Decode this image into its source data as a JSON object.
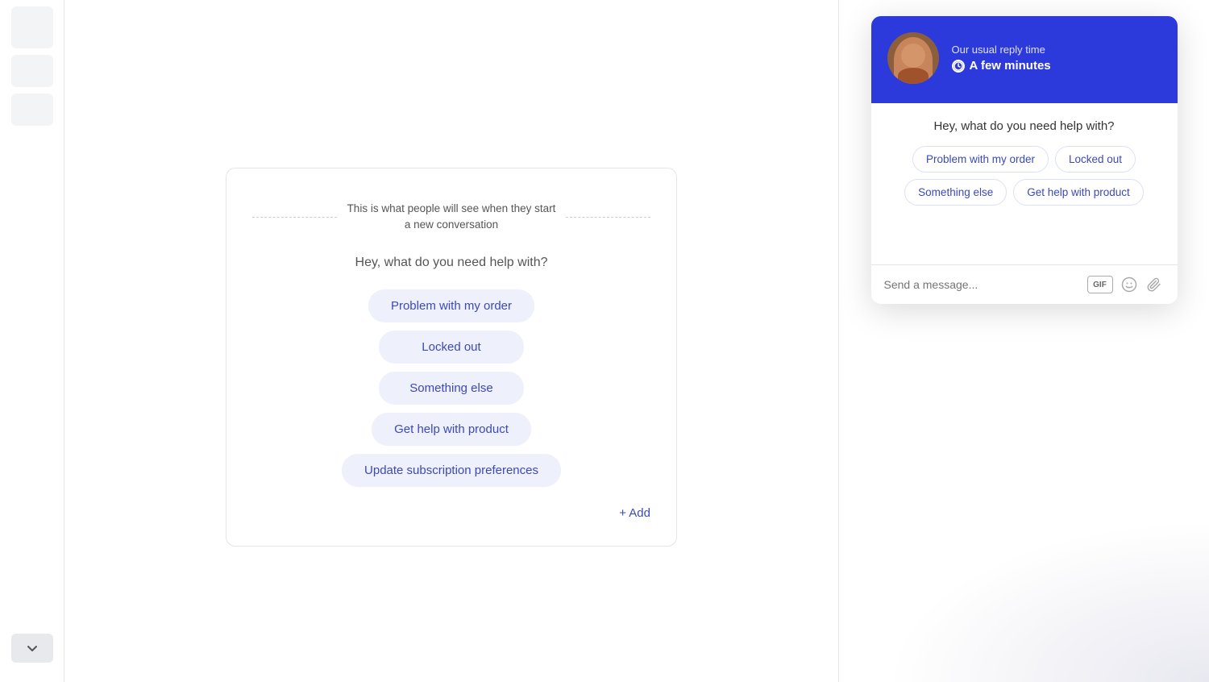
{
  "sidebar": {
    "items": [
      {
        "id": "item1"
      },
      {
        "id": "item2"
      },
      {
        "id": "item3"
      },
      {
        "id": "item4"
      }
    ],
    "dropdown_label": "▾"
  },
  "editor": {
    "divider_text": "This is what people will see when they start a new conversation",
    "prompt_text": "Hey, what do you need help with?",
    "options": [
      {
        "label": "Problem with my order"
      },
      {
        "label": "Locked out"
      },
      {
        "label": "Something else"
      },
      {
        "label": "Get help with product"
      },
      {
        "label": "Update subscription preferences"
      }
    ],
    "add_button_label": "+ Add"
  },
  "chat_widget": {
    "header": {
      "reply_time_label": "Our usual reply time",
      "reply_time_value": "A few minutes",
      "clock_icon": "⏱"
    },
    "body": {
      "prompt_text": "Hey, what do you need help with?",
      "options": [
        {
          "label": "Problem with my order"
        },
        {
          "label": "Locked out"
        },
        {
          "label": "Something else"
        },
        {
          "label": "Get help with product"
        }
      ]
    },
    "input": {
      "placeholder": "Send a message...",
      "gif_label": "GIF",
      "emoji_label": "😊",
      "attach_label": "📎"
    }
  }
}
